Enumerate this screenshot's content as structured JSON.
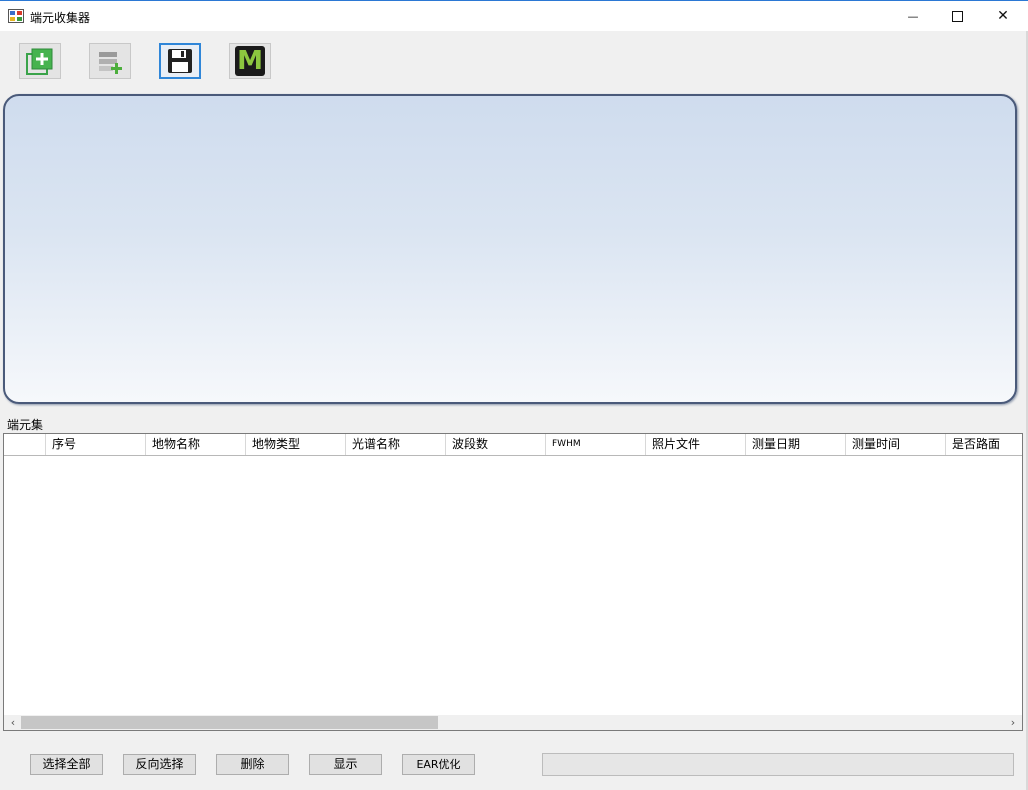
{
  "window": {
    "title": "端元收集器",
    "controls": {
      "minimize": "—",
      "close": "✕"
    }
  },
  "toolbar": {
    "tools": [
      {
        "name": "add-endmember",
        "icon": "green-plus-stack-icon"
      },
      {
        "name": "add-layer",
        "icon": "layers-plus-icon"
      },
      {
        "name": "save",
        "icon": "floppy-disk-icon"
      },
      {
        "name": "m-tool",
        "icon": "m-letter-icon",
        "glyph": "M"
      }
    ]
  },
  "group": {
    "label": "端元集"
  },
  "grid": {
    "columns": [
      "序号",
      "地物名称",
      "地物类型",
      "光谱名称",
      "波段数",
      "FWHM",
      "照片文件",
      "测量日期",
      "测量时间",
      "是否路面"
    ],
    "rows": []
  },
  "scroll": {
    "left": "‹",
    "right": "›"
  },
  "buttons": {
    "select_all": "选择全部",
    "invert": "反向选择",
    "delete": "删除",
    "show": "显示",
    "ear": "EAR优化"
  },
  "progress": {
    "value": 0
  },
  "colors": {
    "accent": "#2f86d8",
    "panel_top": "#cfdcee",
    "panel_border": "#4a5a7a",
    "m_icon": "#8cc63f"
  }
}
